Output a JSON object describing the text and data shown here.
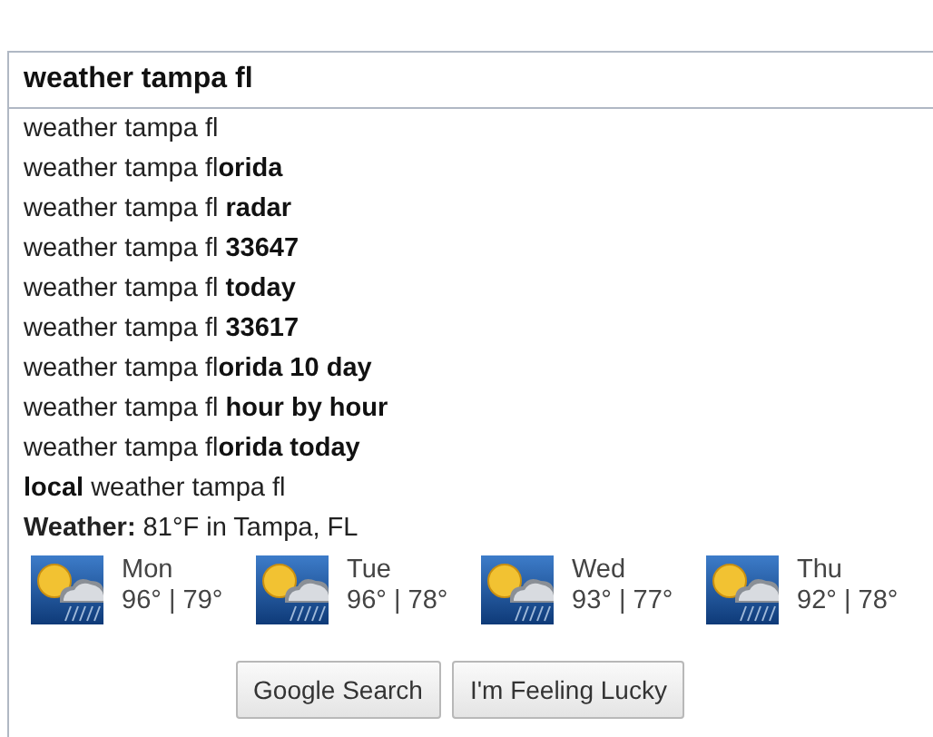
{
  "search": {
    "value": "weather tampa fl"
  },
  "suggestions": [
    "weather tampa fl",
    "weather tampa fl**orida**",
    "weather tampa fl **radar**",
    "weather tampa fl **33647**",
    "weather tampa fl **today**",
    "weather tampa fl **33617**",
    "weather tampa fl**orida 10 day**",
    "weather tampa fl **hour by hour**",
    "weather tampa fl**orida today**",
    "**local** weather tampa fl"
  ],
  "weather": {
    "headline": "**Weather:** 81°F in Tampa, FL",
    "forecast": [
      {
        "day": "Mon",
        "temps": "96° | 79°"
      },
      {
        "day": "Tue",
        "temps": "96° | 78°"
      },
      {
        "day": "Wed",
        "temps": "93° | 77°"
      },
      {
        "day": "Thu",
        "temps": "92° | 78°"
      }
    ]
  },
  "buttons": [
    "Google Search",
    "I'm Feeling Lucky"
  ]
}
